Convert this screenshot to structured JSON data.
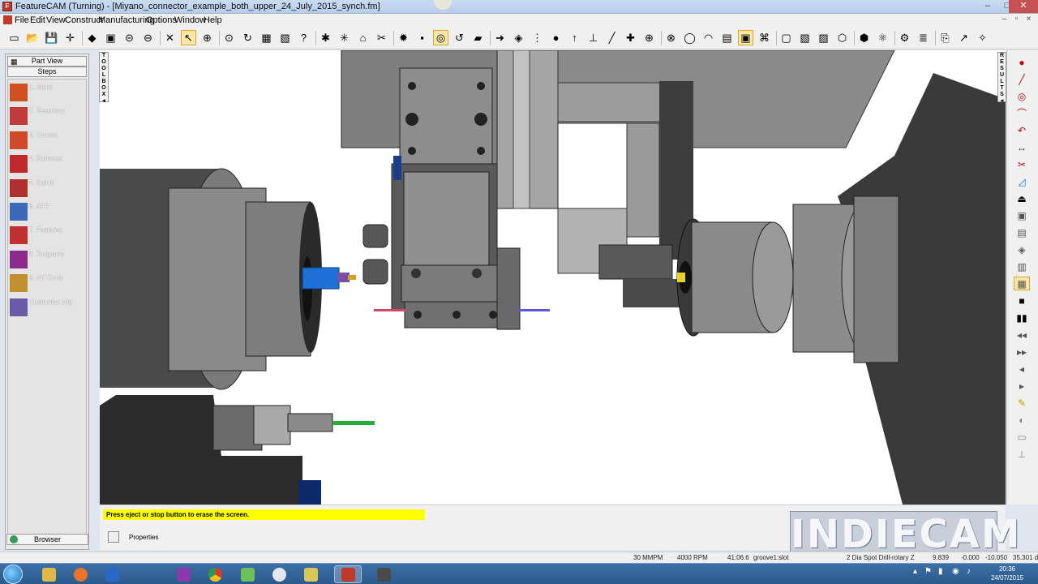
{
  "window": {
    "title": "FeatureCAM (Turning) - [Miyano_connector_example_both_upper_24_July_2015_synch.fm]",
    "minimize_glyph": "–",
    "maximize_glyph": "□",
    "close_glyph": "✕",
    "app_icon_letter": "F"
  },
  "menu": {
    "items": [
      "File",
      "Edit",
      "View",
      "Construct",
      "Manufacturing",
      "Options",
      "Window",
      "Help"
    ],
    "mdi_min": "–",
    "mdi_max": "▫",
    "mdi_close": "×"
  },
  "toolbar": {
    "glyphs": [
      "▭",
      "📂",
      "💾",
      "✛",
      "◆",
      "▣",
      "⊝",
      "⊖",
      "✕",
      "↖",
      "⊕",
      "⊙",
      "↻",
      "▦",
      "▧",
      "?",
      "✱",
      "✳",
      "⌂",
      "✂",
      "✹",
      "▪",
      "◎",
      "↺",
      "▰",
      "➜",
      "◈",
      "⋮",
      "●",
      "↑",
      "⊥",
      "╱",
      "✚",
      "⊕",
      "⊗",
      "◯",
      "◠",
      "▤",
      "▣",
      "⌘",
      "▢",
      "▧",
      "▨",
      "⬡",
      "⬢",
      "⚛",
      "⚙",
      "≣",
      "⎘",
      "↗",
      "✧"
    ]
  },
  "left_panel": {
    "part_view_label": "Part View",
    "steps_label": "Steps",
    "browser_label": "Browser",
    "steps": [
      {
        "label": "1.  Stock",
        "icon": "stock-icon"
      },
      {
        "label": "2.  Geometry",
        "icon": "geometry-icon"
      },
      {
        "label": "3.  Curves",
        "icon": "curves-icon"
      },
      {
        "label": "4.  Surfaces",
        "icon": "surfaces-icon"
      },
      {
        "label": "5.  Solids",
        "icon": "solids-icon"
      },
      {
        "label": "6.  AFR",
        "icon": "afr-icon"
      },
      {
        "label": "7.  Features",
        "icon": "features-icon"
      },
      {
        "label": "8.  Toolpaths",
        "icon": "toolpaths-icon"
      },
      {
        "label": "9.  NC Code",
        "icon": "nc-code-icon"
      },
      {
        "label": "Customize Mfg",
        "icon": "customize-mfg-icon"
      }
    ]
  },
  "toolbox_letters": [
    "T",
    "O",
    "O",
    "L",
    "B",
    "O",
    "X",
    "◂"
  ],
  "results_letters": [
    "R",
    "E",
    "S",
    "U",
    "L",
    "T",
    "S",
    "◂"
  ],
  "message": {
    "text": "Press eject or stop button to erase the screen.",
    "properties_label": "Properties"
  },
  "watermark": "INDIECAM",
  "status": {
    "feed": "30 MMPM",
    "speed": "4000 RPM",
    "time": "41:06.6",
    "op": "groove1:slot",
    "tool": "2 Dia Spot Drill-rotary Z",
    "x": "9.839",
    "y": "-0.000",
    "z": "-10.050",
    "w": "35.301 d"
  },
  "taskbar": {
    "clock_time": "20:36",
    "clock_date": "24/07/2015",
    "tray_glyphs": [
      "▴",
      "⚑",
      "▮",
      "◉",
      "♪"
    ]
  },
  "colors": {
    "title_bg": "#b7cde9",
    "viewport_bg": "#ffffff",
    "machine_gray": "#8a8a8a",
    "machine_dark": "#3c3c3c",
    "tool_blue": "#1e6fd6",
    "message_yellow": "#ffff00",
    "taskbar_blue": "#2b5a8d"
  }
}
